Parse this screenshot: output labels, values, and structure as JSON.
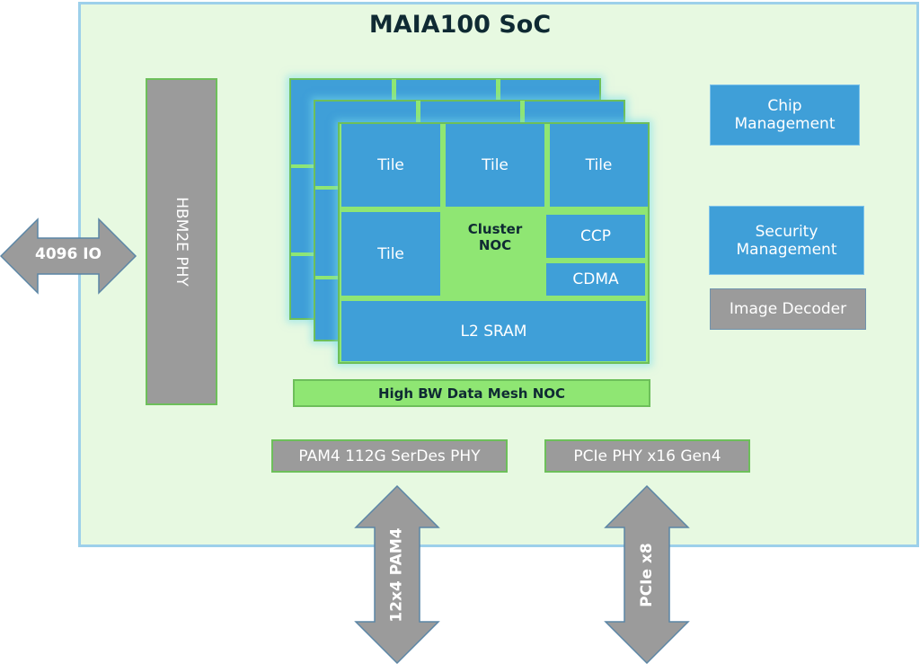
{
  "title": "MAIA100 SoC",
  "hbm_phy": "HBM2E PHY",
  "io_arrow": "4096 IO",
  "cluster": {
    "tiles": [
      "Tile",
      "Tile",
      "Tile",
      "Tile"
    ],
    "cluster_noc_line1": "Cluster",
    "cluster_noc_line2": "NOC",
    "ccp": "CCP",
    "cdma": "CDMA",
    "l2_sram": "L2 SRAM"
  },
  "mesh_noc": "High BW Data Mesh NOC",
  "right_blocks": {
    "chip_management_line1": "Chip",
    "chip_management_line2": "Management",
    "security_management_line1": "Security",
    "security_management_line2": "Management",
    "image_decoder": "Image Decoder"
  },
  "bottom_blocks": {
    "serdes_phy": "PAM4 112G SerDes PHY",
    "pcie_phy": "PCIe PHY x16 Gen4"
  },
  "bottom_arrows": {
    "pam4": "12x4 PAM4",
    "pcie": "PCIe x8"
  },
  "colors": {
    "soc_background": "#e7f9e1",
    "soc_border": "#9dd0ea",
    "block_blue": "#3f9fd8",
    "block_gray": "#9b9b9b",
    "noc_green": "#8fe673"
  }
}
